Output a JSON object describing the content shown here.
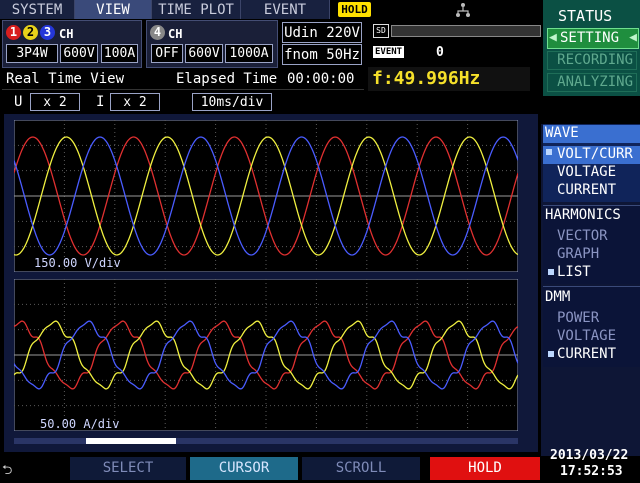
{
  "tabs": [
    {
      "label": "SYSTEM",
      "active": false
    },
    {
      "label": "VIEW",
      "active": true
    },
    {
      "label": "TIME PLOT",
      "active": false
    },
    {
      "label": "EVENT",
      "active": false
    }
  ],
  "hold_badge": "HOLD",
  "ch_group1": {
    "nums": [
      "1",
      "2",
      "3"
    ],
    "suffix": "CH",
    "wiring": "3P4W",
    "voltage": "600V",
    "current": "100A"
  },
  "ch_group2": {
    "num": "4",
    "suffix": "CH",
    "state": "OFF",
    "voltage": "600V",
    "current": "1000A"
  },
  "udin": "Udin 220V",
  "fnom": "fnom  50Hz",
  "sd_label": "SD",
  "event_label": "EVENT",
  "event_count": "0",
  "status": {
    "title": "STATUS",
    "setting": "SETTING",
    "recording": "RECORDING",
    "analyzing": "ANALYZING"
  },
  "info": {
    "view_label": "Real Time View",
    "elapsed_label": "Elapsed Time",
    "elapsed_value": "00:00:00",
    "freq": "f:49.996Hz"
  },
  "scale": {
    "u_label": "U",
    "u_mult": "x 2",
    "i_label": "I",
    "i_mult": "x 2",
    "time_div": "10ms/div"
  },
  "plots": {
    "voltage_div": "150.00 V/div",
    "current_div": "50.00 A/div"
  },
  "menu": {
    "wave_title": "WAVE",
    "wave_items": [
      {
        "label": "VOLT/CURR",
        "selected": true
      },
      {
        "label": "VOLTAGE",
        "selected": false
      },
      {
        "label": "CURRENT",
        "selected": false
      }
    ],
    "harmonics_title": "HARMONICS",
    "harmonics_items": [
      {
        "label": "VECTOR",
        "selected": false
      },
      {
        "label": "GRAPH",
        "selected": false
      },
      {
        "label": "LIST",
        "selected": true
      }
    ],
    "dmm_title": "DMM",
    "dmm_items": [
      {
        "label": "POWER",
        "selected": false
      },
      {
        "label": "VOLTAGE",
        "selected": false
      },
      {
        "label": "CURRENT",
        "selected": true
      }
    ]
  },
  "softkeys": [
    {
      "label": "SELECT"
    },
    {
      "label": "CURSOR"
    },
    {
      "label": "SCROLL"
    },
    {
      "label": "HOLD"
    }
  ],
  "date": "2013/03/22",
  "time": "17:52:53",
  "colors": {
    "phase1": "#e03030",
    "phase2": "#f0f040",
    "phase3": "#4a5cff",
    "accent": "#3fd66b",
    "hold": "#e01010"
  }
}
